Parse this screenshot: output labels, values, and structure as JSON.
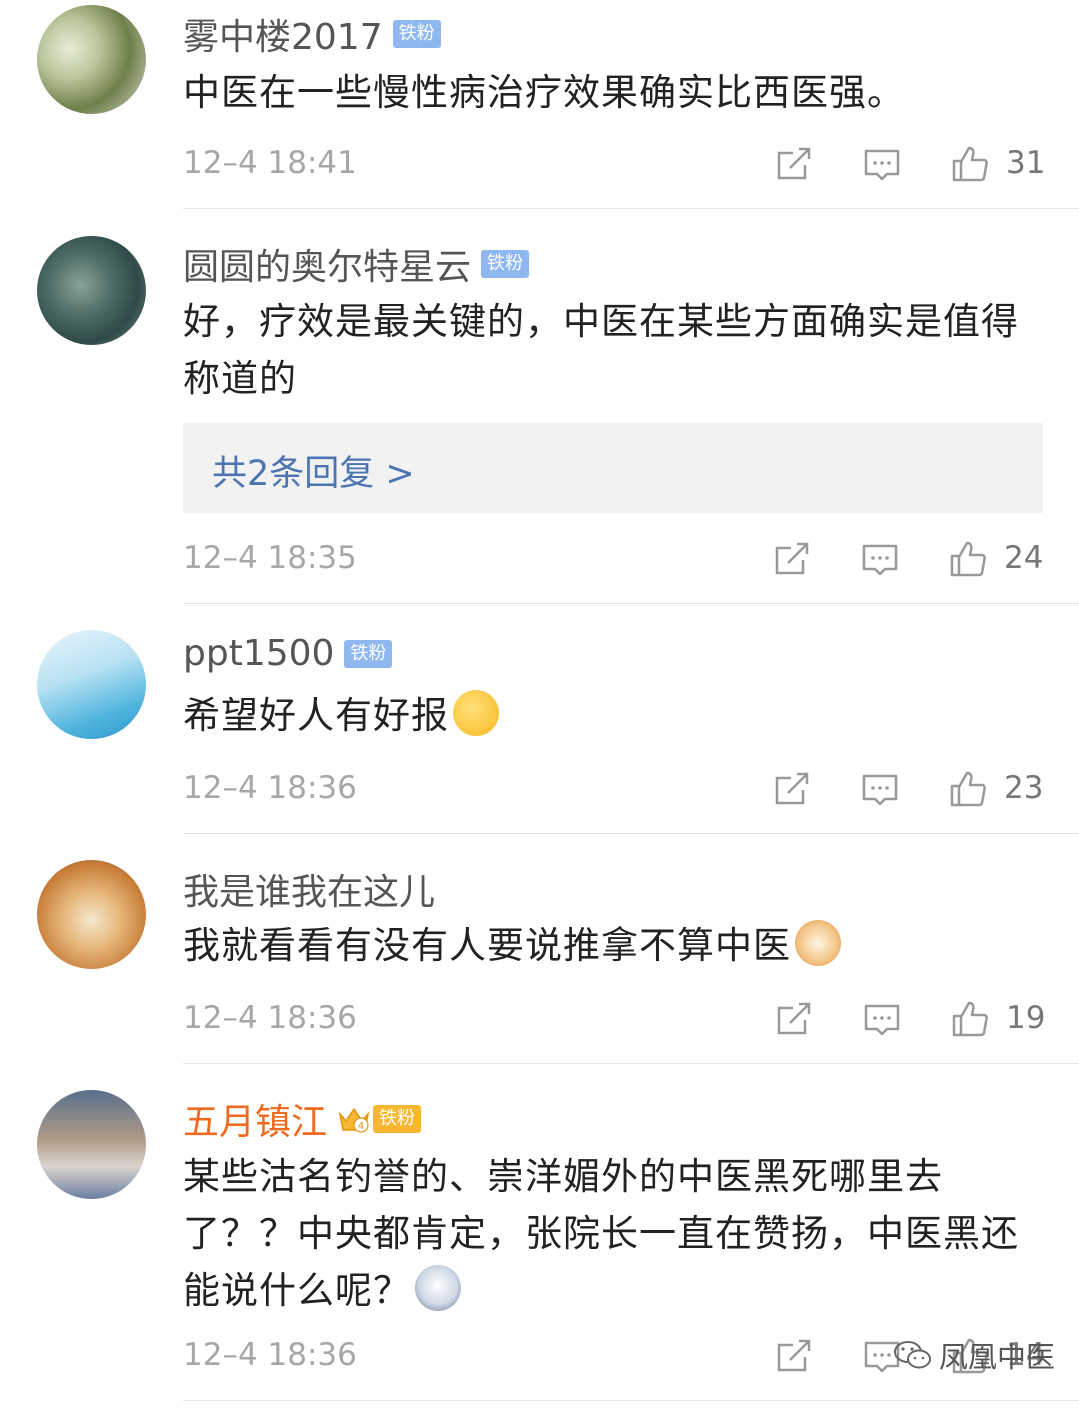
{
  "comments": [
    {
      "username": "雾中楼2017",
      "badge": "铁粉",
      "text": "中医在一些慢性病治疗效果确实比西医强。",
      "time": "12–4 18:41",
      "likes": "31"
    },
    {
      "username": "圆圆的奥尔特星云",
      "badge": "铁粉",
      "text": "好，疗效是最关键的，中医在某些方面确实是值得称道的",
      "replies": "共2条回复 >",
      "time": "12–4 18:35",
      "likes": "24"
    },
    {
      "username": "ppt1500",
      "badge": "铁粉",
      "text": "希望好人有好报",
      "emoji": "smile-emoji",
      "time": "12–4 18:36",
      "likes": "23"
    },
    {
      "username": "我是谁我在这儿",
      "text": "我就看看有没有人要说推拿不算中医",
      "emoji": "cat-emoji",
      "time": "12–4 18:36",
      "likes": "19"
    },
    {
      "username": "五月镇江",
      "badge": "铁粉",
      "vip_level": "4",
      "text": "某些沽名钓誉的、崇洋媚外的中医黑死哪里去了？？中央都肯定，张院长一直在赞扬，中医黑还能说什么呢？",
      "emoji": "husky-emoji",
      "time": "12–4 18:36",
      "likes": "14"
    }
  ],
  "watermark": "凤凰中医",
  "colors": {
    "username": "#555555",
    "vip_username": "#f06b20",
    "badge": "#8fb7f0",
    "vip_badge": "#f7b733",
    "reply_link": "#4b74b0",
    "timestamp": "#a7a7a7"
  }
}
